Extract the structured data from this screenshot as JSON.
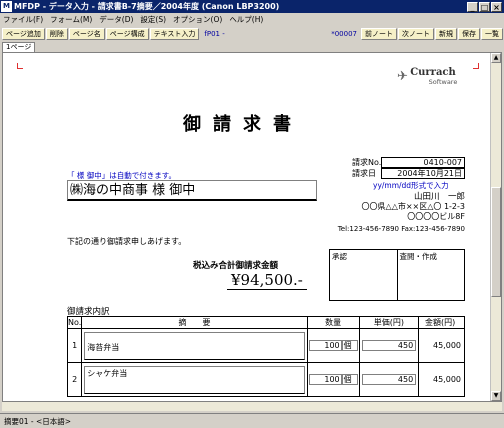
{
  "window": {
    "title": "MFDP - データ入力 - 請求書B-7摘要／2004年度 (Canon LBP3200)",
    "controls": [
      "_",
      "□",
      "×"
    ]
  },
  "menu": [
    "ファイル(F)",
    "フォーム(M)",
    "データ(D)",
    "設定(S)",
    "オプション(O)",
    "ヘルプ(H)"
  ],
  "toolbar": {
    "left": [
      "ページ追加",
      "削除",
      "ページ名",
      "ページ構成",
      "テキスト入力"
    ],
    "info": "fP01 -",
    "record": "*00007",
    "right": [
      "前ノート",
      "次ノート",
      "新規",
      "保存",
      "一覧"
    ]
  },
  "tabs": [
    "1ページ"
  ],
  "logo": {
    "brand": "Currach",
    "sub": "Software"
  },
  "document": {
    "title": "御請求書",
    "auto_note": "「 様 御中」は自動で付きます。",
    "customer": "㈱海の中商事 様 御中",
    "req_no_label": "請求No.",
    "req_no": "0410-007",
    "req_date_label": "請求日",
    "req_date": "2004年10月21日",
    "date_format_note": "yy/mm/dd形式で入力",
    "issuer": "山田川　一郎",
    "address1": "〇〇県△△市××区△〇 1-2-3",
    "address2": "〇〇〇〇ビル8F",
    "tel": "Tel:123-456-7890 Fax:123-456-7890",
    "intro": "下記の通り御請求申しあげます。",
    "tax_label": "税込み合計御請求金額",
    "total": "¥94,500.-",
    "stamp": {
      "approve": "承認",
      "check": "査閲・作成"
    },
    "detail_title": "御請求内訳",
    "columns": {
      "no": "No.",
      "desc": "摘　　要",
      "qty": "数量",
      "price": "単価(円)",
      "amount": "金額(円)"
    },
    "rows": [
      {
        "no": "1",
        "desc": "海苔弁当",
        "qty": "100",
        "unit": "個",
        "price": "450",
        "amount": "45,000"
      },
      {
        "no": "2",
        "desc": "シャケ弁当",
        "qty": "100",
        "unit": "個",
        "price": "450",
        "amount": "45,000"
      }
    ]
  },
  "status": "摘要01 - <日本語>"
}
